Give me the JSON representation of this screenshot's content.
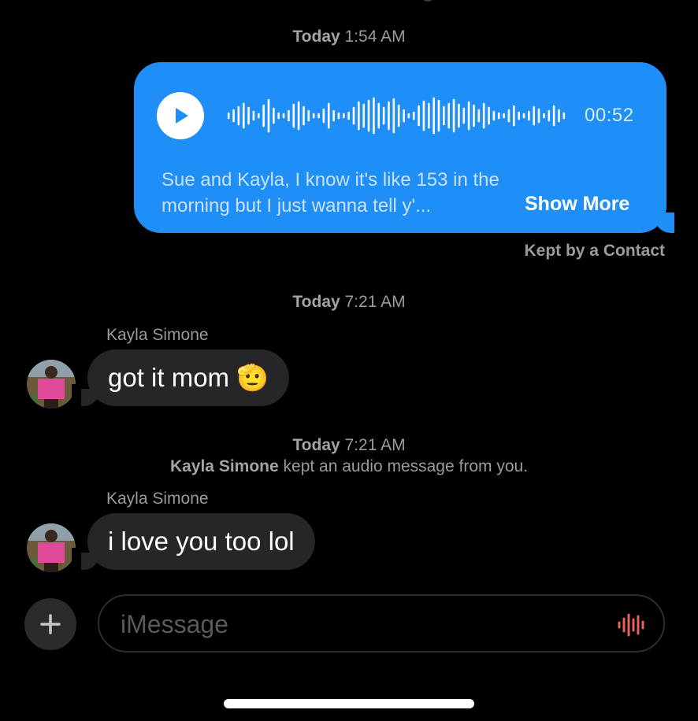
{
  "thread": {
    "timestamp1": {
      "day": "Today",
      "time": "1:54 AM"
    },
    "audio_message": {
      "duration": "00:52",
      "transcript": "Sue and Kayla, I know it's like 153 in the morning but I just wanna tell y'...",
      "show_more_label": "Show More",
      "play_icon": "play-icon",
      "color": "#1f8ef7"
    },
    "kept_label": "Kept by a Contact",
    "timestamp2": {
      "day": "Today",
      "time": "7:21 AM"
    },
    "message1": {
      "sender": "Kayla Simone",
      "text": "got it mom 🫡"
    },
    "timestamp3": {
      "day": "Today",
      "time": "7:21 AM"
    },
    "system_note": {
      "bold": "Kayla Simone",
      "rest": " kept an audio message from you."
    },
    "message2": {
      "sender": "Kayla Simone",
      "text": "i love you too lol"
    }
  },
  "composer": {
    "placeholder": "iMessage",
    "add_icon": "plus-icon",
    "audio_icon": "waveform-icon",
    "audio_icon_color": "#e5635a"
  }
}
